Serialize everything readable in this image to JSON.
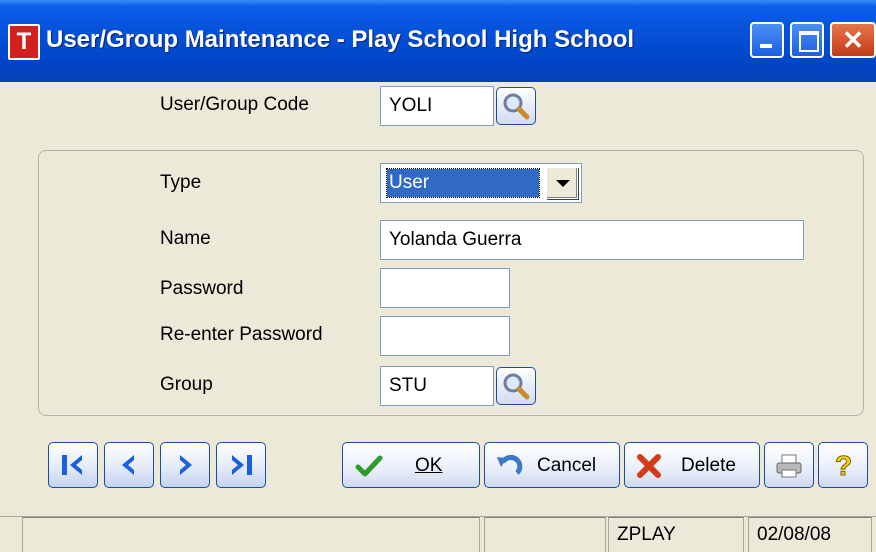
{
  "window": {
    "title": "User/Group Maintenance - Play School High School",
    "app_icon_letter": "T"
  },
  "form": {
    "code_label": "User/Group Code",
    "code_value": "YOLI",
    "type_label": "Type",
    "type_value": "User",
    "name_label": "Name",
    "name_value": "Yolanda Guerra",
    "password_label": "Password",
    "password_value": "",
    "reenter_label": "Re-enter Password",
    "reenter_value": "",
    "group_label": "Group",
    "group_value": "STU"
  },
  "buttons": {
    "ok": "OK",
    "cancel": "Cancel",
    "delete": "Delete"
  },
  "status": {
    "pane1": "",
    "pane2": "",
    "company": "ZPLAY",
    "date": "02/08/08"
  },
  "colors": {
    "title_bar": "#0551d8",
    "accent_nav": "#1a5fe0",
    "selection": "#316ac5"
  }
}
